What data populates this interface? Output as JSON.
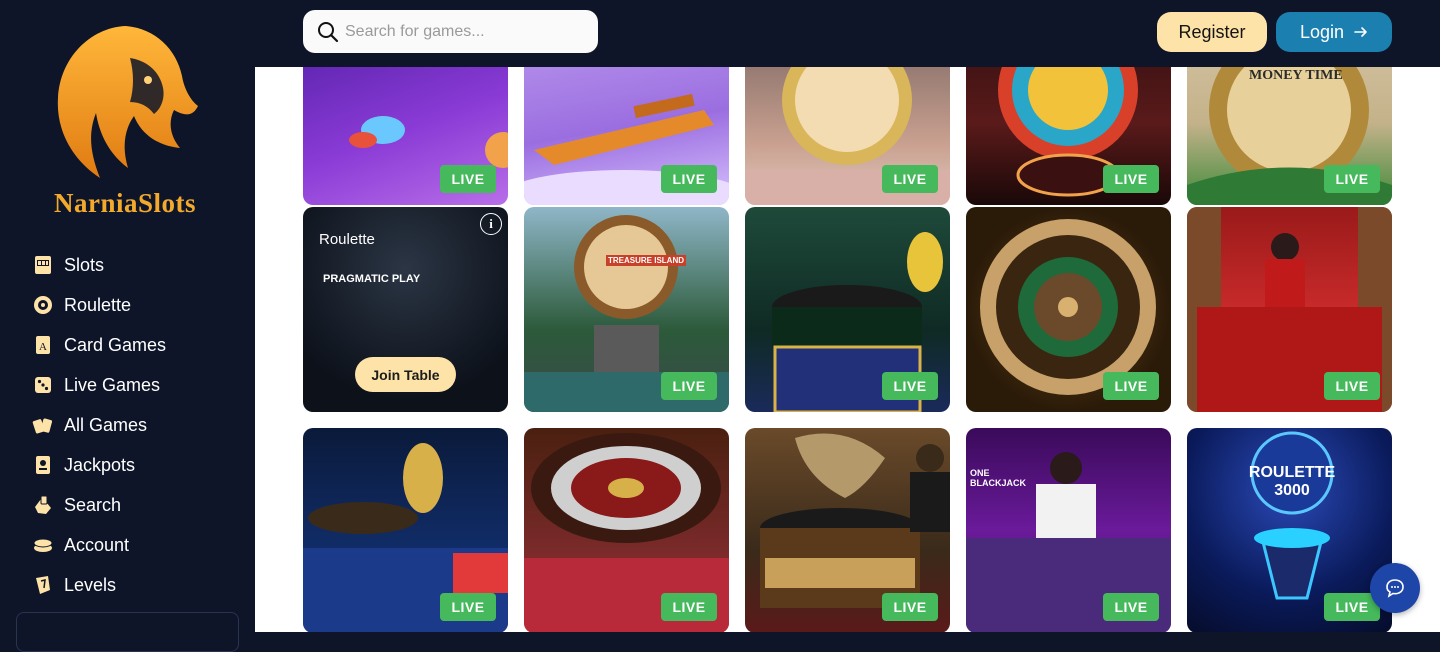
{
  "brand": {
    "name": "NarniaSlots"
  },
  "sidebar": {
    "items": [
      {
        "label": "Slots",
        "icon": "slot-machine-icon"
      },
      {
        "label": "Roulette",
        "icon": "roulette-icon"
      },
      {
        "label": "Card Games",
        "icon": "card-icon"
      },
      {
        "label": "Live Games",
        "icon": "dice-icon"
      },
      {
        "label": "All Games",
        "icon": "cards-fan-icon"
      },
      {
        "label": "Jackpots",
        "icon": "jackpot-icon"
      },
      {
        "label": "Search",
        "icon": "search-hand-icon"
      },
      {
        "label": "Account",
        "icon": "coins-icon"
      },
      {
        "label": "Levels",
        "icon": "levels-icon"
      }
    ]
  },
  "header": {
    "search_placeholder": "Search for games...",
    "register_label": "Register",
    "login_label": "Login"
  },
  "games": {
    "live_badge": "LIVE",
    "hover_tile": {
      "title": "Roulette",
      "provider": "PRAGMATIC PLAY",
      "join_label": "Join Table"
    },
    "tile_titles": {
      "money_time": "MONEY TIME",
      "treasure_island": "TREASURE ISLAND",
      "mega_roulette": "ROULETTE",
      "mega_roulette_3000": "ROULETTE 3000",
      "one_blackjack": "ONE BLACKJACK"
    }
  },
  "colors": {
    "background": "#0e1529",
    "accent_gold": "#f2a92c",
    "register_bg": "#fde3a7",
    "login_bg": "#1b7fb0",
    "live_green": "#45b95c",
    "chat_blue": "#1e45a8"
  }
}
